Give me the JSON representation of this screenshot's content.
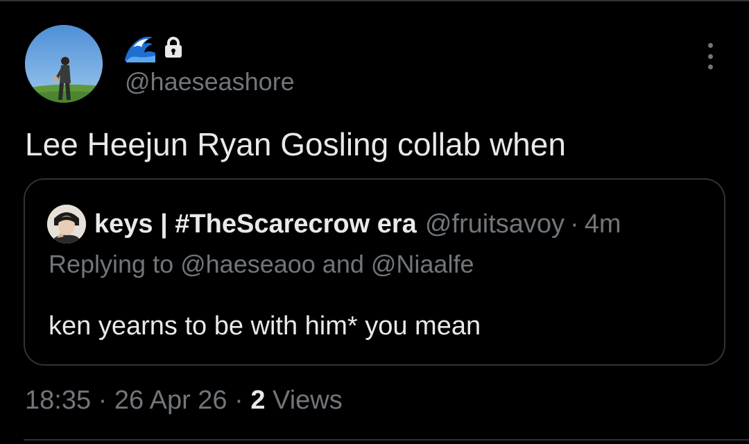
{
  "author": {
    "display_name_emoji": "🌊",
    "protected_icon": "lock-icon",
    "handle": "@haeseashore",
    "avatar_icon": "profile-photo-avatar"
  },
  "tweet": {
    "text": "Lee Heejun Ryan Gosling collab when"
  },
  "more_menu": {
    "icon": "more-vertical-icon"
  },
  "quoted_tweet": {
    "avatar_icon": "quoted-profile-photo-avatar",
    "display_name": "keys | #TheScarecrow era",
    "handle": "@fruitsavoy",
    "separator": "·",
    "time": "4m",
    "replying_to": "Replying to @haeseaoo and @Niaalfe",
    "text": "ken yearns to be with him* you mean"
  },
  "meta": {
    "time": "18:35",
    "sep1": "·",
    "date": "26 Apr 26",
    "sep2": "·",
    "views_count": "2",
    "views_label": "Views"
  },
  "colors": {
    "background": "#000000",
    "primary_text": "#e7e9ea",
    "secondary_text": "#71767b",
    "border": "#2f3336"
  }
}
